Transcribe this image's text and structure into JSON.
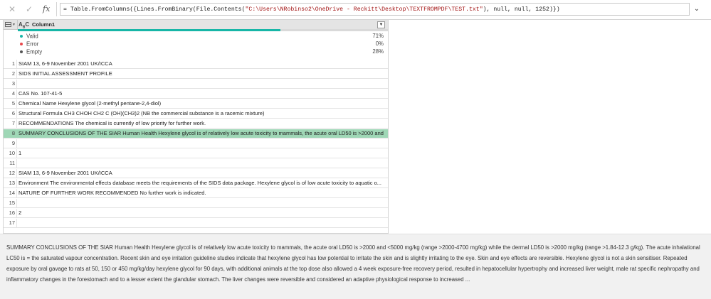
{
  "formula_bar": {
    "cancel_icon": "close-icon",
    "commit_icon": "check-icon",
    "fx_label": "fx",
    "formula_prefix": "= Table.FromColumns({Lines.FromBinary(File.Contents(",
    "formula_path": "\"C:\\Users\\NRobinso2\\OneDrive - Reckitt\\Desktop\\TEXTFROMPDF\\TEST.txt\"",
    "formula_suffix": "), null, null, 1252)})"
  },
  "grid": {
    "column_type": "ABC",
    "column_name": "Column1",
    "quality": {
      "valid_label": "Valid",
      "valid_value": "71%",
      "error_label": "Error",
      "error_value": "0%",
      "empty_label": "Empty",
      "empty_value": "28%",
      "valid_fraction": 0.71,
      "colors": {
        "valid": "#17b6a7",
        "error": "#e8474b",
        "empty": "#555555"
      }
    },
    "rows": [
      {
        "num": "1",
        "text": "SIAM 13, 6-9 November 2001 UK/ICCA"
      },
      {
        "num": "2",
        "text": "SIDS INITIAL ASSESSMENT PROFILE"
      },
      {
        "num": "3",
        "text": ""
      },
      {
        "num": "4",
        "text": "CAS No.  107-41-5"
      },
      {
        "num": "5",
        "text": "Chemical Name  Hexylene glycol (2-methyl pentane-2,4-diol)"
      },
      {
        "num": "6",
        "text": "Structural Formula  CH3 CHOH CH2 C (OH)(CH3)2 (NB the commercial substance is a racemic mixture)"
      },
      {
        "num": "7",
        "text": "RECOMMENDATIONS The chemical is currently of low priority for further work."
      },
      {
        "num": "8",
        "text": "SUMMARY CONCLUSIONS OF THE SIAR Human Health Hexylene glycol is of relatively low acute toxicity to mammals, the acute oral LD50 is >2000 and <..."
      },
      {
        "num": "9",
        "text": ""
      },
      {
        "num": "10",
        "text": "1"
      },
      {
        "num": "11",
        "text": ""
      },
      {
        "num": "12",
        "text": "SIAM 13, 6-9 November 2001 UK/ICCA"
      },
      {
        "num": "13",
        "text": "Environment The environmental effects database meets the requirements of the SIDS data package. Hexylene glycol is of low acute toxicity to aquatic o..."
      },
      {
        "num": "14",
        "text": "NATURE OF FURTHER WORK RECOMMENDED No further work is indicated."
      },
      {
        "num": "15",
        "text": ""
      },
      {
        "num": "16",
        "text": "2"
      },
      {
        "num": "17",
        "text": ""
      }
    ],
    "selected_row": "8"
  },
  "preview": {
    "text": "SUMMARY CONCLUSIONS OF THE SIAR Human Health Hexylene glycol is of relatively low acute toxicity to mammals, the acute oral LD50 is >2000 and <5000 mg/kg (range >2000-4700 mg/kg) while the dermal LD50 is >2000 mg/kg (range >1.84-12.3 g/kg). The acute inhalational LC50 is = the saturated vapour concentration. Recent skin and eye irritation guideline studies indicate that hexylene glycol has low potential to irritate the skin and is slightly irritating to the eye. Skin and eye effects are reversible. Hexylene glycol is not a skin sensitiser. Repeated exposure by oral gavage to rats at 50, 150 or 450 mg/kg/day hexylene glycol for 90 days, with additional animals at the top dose also allowed a 4 week exposure-free recovery period, resulted in hepatocellular hypertrophy and increased liver weight, male rat specific nephropathy and inflammatory changes in the forestomach and to a lesser extent the glandular stomach. The liver changes were reversible and considered an adaptive physiological response to increased ..."
  }
}
